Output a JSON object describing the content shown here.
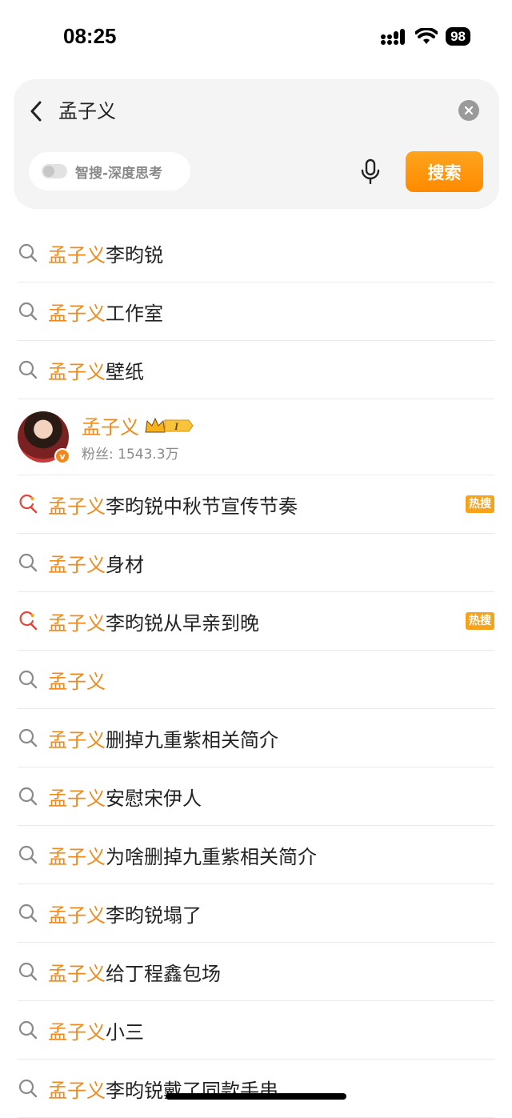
{
  "status_bar": {
    "time": "08:25",
    "battery": "98"
  },
  "search": {
    "query": "孟子义",
    "smart_toggle_label": "智搜-深度思考",
    "search_button": "搜索"
  },
  "suggestions": [
    {
      "type": "query",
      "highlight": "孟子义",
      "rest": "李昀锐",
      "hot": false
    },
    {
      "type": "query",
      "highlight": "孟子义",
      "rest": "工作室",
      "hot": false
    },
    {
      "type": "query",
      "highlight": "孟子义",
      "rest": "壁纸",
      "hot": false
    },
    {
      "type": "user",
      "name": "孟子义",
      "fans": "粉丝: 1543.3万",
      "level": "I"
    },
    {
      "type": "query",
      "highlight": "孟子义",
      "rest": "李昀锐中秋节宣传节奏",
      "hot": true,
      "badge": "热搜"
    },
    {
      "type": "query",
      "highlight": "孟子义",
      "rest": "身材",
      "hot": false
    },
    {
      "type": "query",
      "highlight": "孟子义",
      "rest": "李昀锐从早亲到晚",
      "hot": true,
      "badge": "热搜"
    },
    {
      "type": "query",
      "highlight": "孟子义",
      "rest": "",
      "hot": false
    },
    {
      "type": "query",
      "highlight": "孟子义",
      "rest": "删掉九重紫相关简介",
      "hot": false
    },
    {
      "type": "query",
      "highlight": "孟子义",
      "rest": "安慰宋伊人",
      "hot": false
    },
    {
      "type": "query",
      "highlight": "孟子义",
      "rest": "为啥删掉九重紫相关简介",
      "hot": false
    },
    {
      "type": "query",
      "highlight": "孟子义",
      "rest": "李昀锐塌了",
      "hot": false
    },
    {
      "type": "query",
      "highlight": "孟子义",
      "rest": "给丁程鑫包场",
      "hot": false
    },
    {
      "type": "query",
      "highlight": "孟子义",
      "rest": "小三",
      "hot": false
    },
    {
      "type": "query",
      "highlight": "孟子义",
      "rest": "李昀锐戴了同款手串",
      "hot": false
    }
  ],
  "colors": {
    "accent": "#f08a1c",
    "hot_icon": "#e0463a",
    "badge": "#f7a21b"
  }
}
